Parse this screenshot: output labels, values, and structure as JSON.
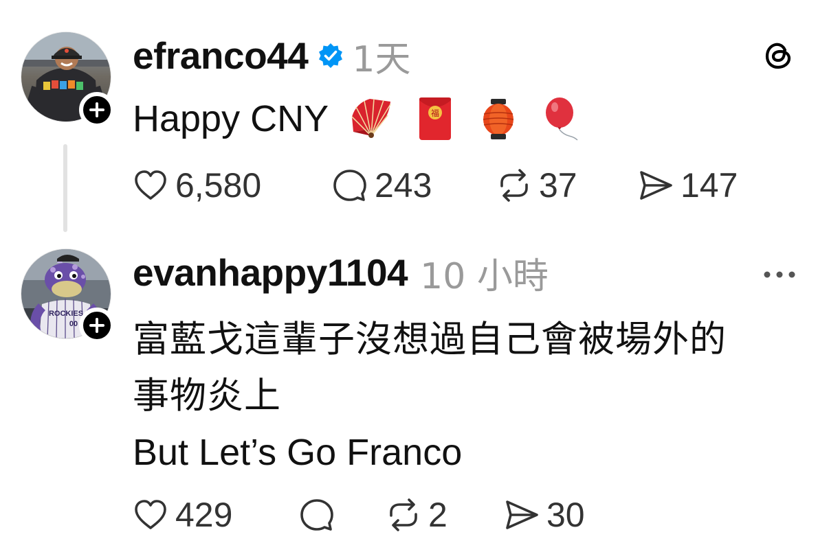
{
  "posts": [
    {
      "username": "efranco44",
      "verified": true,
      "timestamp": "1天",
      "text": "Happy CNY",
      "emojis": [
        "folding-fan",
        "red-envelope",
        "red-lantern",
        "balloon"
      ],
      "stats": {
        "likes": "6,580",
        "replies": "243",
        "reposts": "37",
        "shares": "147"
      },
      "corner_icon": "threads-logo-icon"
    },
    {
      "username": "evanhappy1104",
      "verified": false,
      "timestamp": "10 小時",
      "text_lines": [
        "富藍戈這輩子沒想過自己會被場外的",
        "事物炎上",
        "But Let’s Go Franco"
      ],
      "stats": {
        "likes": "429",
        "replies": "",
        "reposts": "2",
        "shares": "30"
      },
      "corner_icon": "more-options-icon"
    }
  ],
  "colors": {
    "verified_blue": "#0095f6",
    "timestamp_gray": "#9a9a9a",
    "thread_line": "#e2e2e2"
  }
}
